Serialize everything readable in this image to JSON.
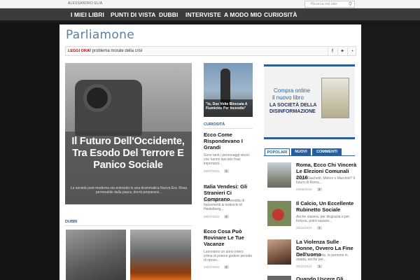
{
  "topbar": {
    "author": "ALESSANDRO ELIA",
    "search_placeholder": "Ricerca nel sito"
  },
  "nav": [
    "I MIEI LIBRI",
    "PUNTI DI VISTA",
    "DUBBI",
    "INTERVISTE",
    "A MODO MIO",
    "CURIOSITÀ"
  ],
  "logo": "Parliamone",
  "ticker": {
    "label": "LEGGI ORA",
    "text": "Il problema morale della crisi"
  },
  "hero": {
    "title": "Il Futuro Dell'Occidente, Tra Esodo Del Terrore E Panico Sociale",
    "summary": "La società post-moderna sta entrando in una drammatica Nuova Era. Resa permeabile dalla paura, dovrà prepararsi..."
  },
  "dubbi": {
    "label": "DUBBI"
  },
  "curiosita": {
    "caption": "\"Io, Due Volte Bloccata A Fiumicino Per Incendio\"",
    "label": "CURIOSITÀ",
    "articles": [
      {
        "title": "Ecco Come Rispondevano I Grandi",
        "summary": "Sono tanti i personaggi storici che hanno lasciato frasi importanti...",
        "date": "30/07/2015",
        "comments": "0"
      },
      {
        "title": "Italia Vendesi: Gli Stranieri Ci Comprano",
        "summary": "Dopo la recente vendita di Italcementi ai tedeschi di Heidelberg,...",
        "date": "29/07/2015",
        "comments": "0"
      },
      {
        "title": "Ecco Cosa Può Rovinare Le Tue Vacanze",
        "summary": "Lavoriamo un anno intero prima di potersi godere periodo di riposo...",
        "date": "24/07/2015",
        "comments": "0"
      }
    ]
  },
  "ad": {
    "line1": "Compra online",
    "line2": "il nuovo libro",
    "line3": "LA SOCIETÀ DELLA",
    "line4": "DISINFORMAZIONE"
  },
  "tabs": [
    "POPOLARI",
    "NUOVI",
    "COMMENTI"
  ],
  "popular": [
    {
      "title": "Roma, Ecco Chi Vincerà Le Elezioni Comunali 2016",
      "summary": "Raggi, Giachetti, Meloni o Marchini? Il futuro di Roma...",
      "date": "03/06/2016",
      "comments": "2"
    },
    {
      "title": "Il Calcio, Un Eccellente Rubinetto Sociale",
      "summary": "Anche stasera, per disgrazia o per fortuna, potrò saziare...",
      "date": "25/11/2013",
      "comments": "1"
    },
    {
      "title": "La Violenza Sulle Donne, Ovvero La Fine Dell'uomo",
      "summary": "Osservare la gente, le persone in strada, anche per...",
      "date": "26/11/2013",
      "comments": "1"
    },
    {
      "title": "Quando Uscere Gli...",
      "summary": "",
      "date": "",
      "comments": ""
    }
  ],
  "colors": {
    "accent": "#2a5f9e",
    "nav_bg": "#3b3b3b",
    "ticker_label": "#b5121b"
  }
}
